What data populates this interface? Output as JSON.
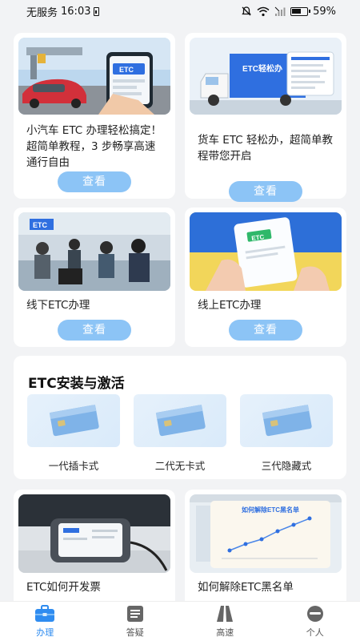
{
  "status_bar": {
    "carrier": "无服务",
    "time": "16:03",
    "battery": "59%"
  },
  "cards": [
    {
      "text": "小汽车 ETC 办理轻松搞定！超简单教程，3 步畅享高速通行自由",
      "button": "查看",
      "image": "car-toll-etc-photo"
    },
    {
      "text": "货车 ETC 轻松办，超简单教程带您开启",
      "button": "查看",
      "image": "truck-etc-illustration"
    },
    {
      "text": "线下ETC办理",
      "button": "查看",
      "image": "offline-service-hall-photo"
    },
    {
      "text": "线上ETC办理",
      "button": "查看",
      "image": "online-etc-card-photo"
    }
  ],
  "install": {
    "title": "ETC安装与激活",
    "items": [
      {
        "label": "一代插卡式",
        "icon": "etc-card-icon"
      },
      {
        "label": "二代无卡式",
        "icon": "etc-card-icon"
      },
      {
        "label": "三代隐藏式",
        "icon": "etc-card-icon"
      }
    ]
  },
  "bottom_cards": [
    {
      "text": "ETC如何开发票",
      "image": "etc-device-photo"
    },
    {
      "text": "如何解除ETC黑名单",
      "image": "blacklist-chart-illustration",
      "image_caption": "如何解除ETC黑名单"
    }
  ],
  "thumb_labels": {
    "etc": "ETC",
    "truck": "ETC轻松办"
  },
  "tabs": [
    {
      "label": "办理",
      "icon": "briefcase-icon",
      "active": true
    },
    {
      "label": "答疑",
      "icon": "document-icon",
      "active": false
    },
    {
      "label": "高速",
      "icon": "highway-icon",
      "active": false
    },
    {
      "label": "个人",
      "icon": "person-icon",
      "active": false
    }
  ],
  "colors": {
    "accent": "#2f8cf0",
    "button": "#8cc4f6",
    "background": "#f2f3f5"
  }
}
